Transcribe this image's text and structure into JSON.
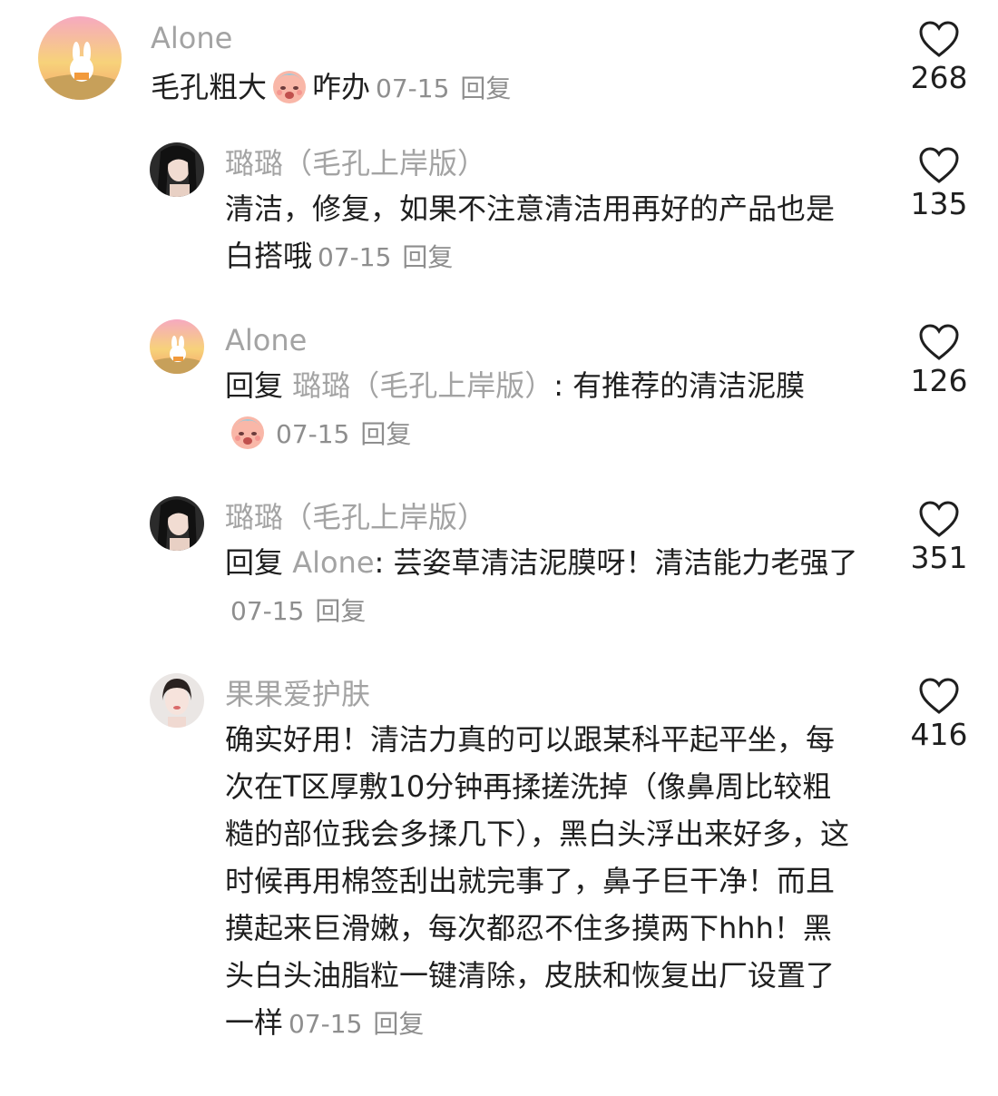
{
  "comments": [
    {
      "user": "Alone",
      "text_before": "毛孔粗大",
      "emoji": "crying-blush-emoji",
      "text_after": "咋办",
      "date": "07-15",
      "reply": "回复",
      "likes": "268"
    },
    {
      "user": "璐璐（毛孔上岸版）",
      "text": "清洁，修复，如果不注意清洁用再好的产品也是白搭哦",
      "date": "07-15",
      "reply": "回复",
      "likes": "135"
    },
    {
      "user": "Alone",
      "reply_word": "回复",
      "mention": "璐璐（毛孔上岸版）",
      "text": ": 有推荐的清洁泥膜",
      "emoji": "crying-blush-emoji",
      "date": "07-15",
      "reply": "回复",
      "likes": "126"
    },
    {
      "user": "璐璐（毛孔上岸版）",
      "reply_word": "回复",
      "mention": "Alone",
      "text": ": 芸姿草清洁泥膜呀！清洁能力老强了",
      "date": "07-15",
      "reply": "回复",
      "likes": "351"
    },
    {
      "user": "果果爱护肤",
      "text": "确实好用！清洁力真的可以跟某科平起平坐，每次在T区厚敷10分钟再揉搓洗掉（像鼻周比较粗糙的部位我会多揉几下），黑白头浮出来好多，这时候再用棉签刮出就完事了，鼻子巨干净！而且摸起来巨滑嫩，每次都忍不住多摸两下hhh！黑头白头油脂粒一键清除，皮肤和恢复出厂设置了一样",
      "date": "07-15",
      "reply": "回复",
      "likes": "416"
    }
  ],
  "icons": {
    "like": "heart-outline-icon"
  }
}
